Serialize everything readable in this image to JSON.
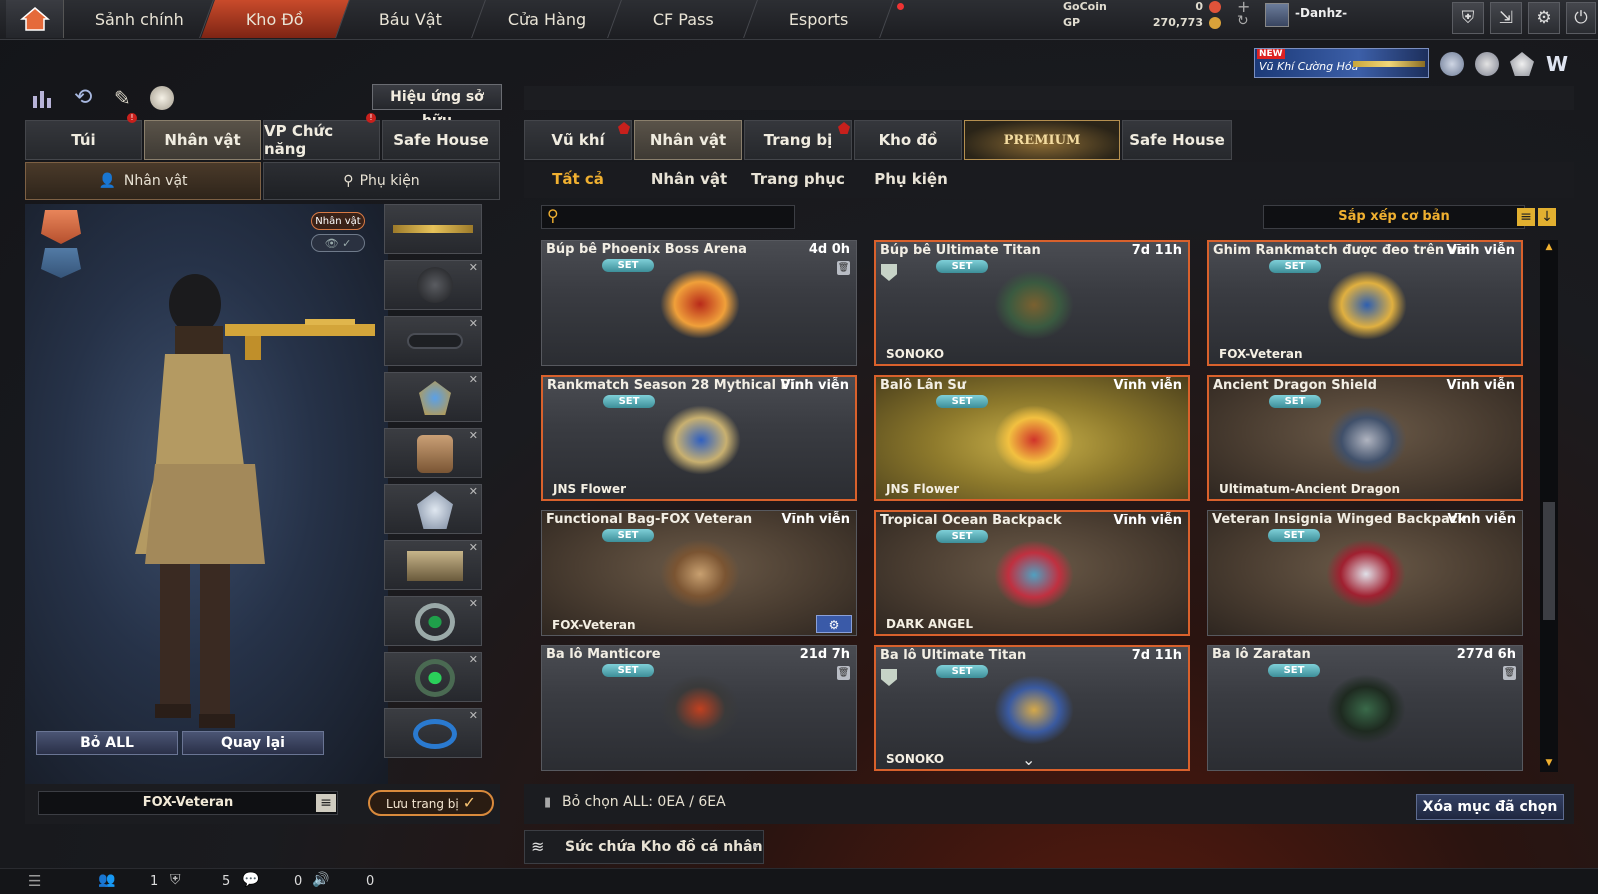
{
  "nav": {
    "tabs": [
      "Sảnh chính",
      "Kho Đồ",
      "Báu Vật",
      "Cửa Hàng",
      "CF Pass",
      "Esports"
    ],
    "active": "Kho Đồ"
  },
  "currency": {
    "gocoin_label": "GoCoin",
    "gocoin_value": "0",
    "gp_label": "GP",
    "gp_value": "270,773"
  },
  "player": {
    "name": "-Danhz-"
  },
  "banner": {
    "new_label": "NEW",
    "title": "Vũ Khí Cường Hóa"
  },
  "left": {
    "effect_button": "Hiệu ứng sở hữu",
    "tabs": [
      "Túi",
      "Nhân vật",
      "VP Chức năng",
      "Safe House"
    ],
    "subtabs": [
      "Nhân vật",
      "Phụ kiện"
    ],
    "char_badge": "Nhân vật ✓",
    "remove_all": "Bỏ ALL",
    "back": "Quay lại",
    "preset_name": "FOX-Veteran",
    "save_button": "Lưu trang bị"
  },
  "right": {
    "tabs": [
      "Vũ khí",
      "Nhân vật",
      "Trang bị",
      "Kho đồ",
      "PREMIUM",
      "Safe House"
    ],
    "subtabs": [
      "Tất cả",
      "Nhân vật",
      "Trang phục",
      "Phụ kiện"
    ],
    "search_placeholder": "",
    "sort_label": "Sắp xếp cơ bản",
    "set_label": "SET",
    "selection_info": "Bỏ chọn ALL: 0EA / 6EA",
    "delete_button": "Xóa mục đã chọn",
    "capacity_label": "Sức chứa Kho đồ cá nhân",
    "items": [
      {
        "name": "Búp bê Phoenix Boss Arena",
        "time": "4d 0h",
        "owner": "",
        "style": "plain",
        "trash": true,
        "shield": false
      },
      {
        "name": "Búp bê Ultimate Titan",
        "time": "7d 11h",
        "owner": "SONOKO",
        "style": "orange",
        "trash": false,
        "shield": true
      },
      {
        "name": "Ghim Rankmatch được đeo trên vai",
        "time": "Vĩnh viễn",
        "owner": "FOX-Veteran",
        "style": "orange",
        "trash": false,
        "shield": false
      },
      {
        "name": "Rankmatch Season 28 Mythical Pin",
        "time": "Vĩnh viễn",
        "owner": "JNS Flower",
        "style": "orange",
        "trash": false,
        "shield": false
      },
      {
        "name": "Balô Lân Sư",
        "time": "Vĩnh viễn",
        "owner": "JNS Flower",
        "style": "gold",
        "trash": false,
        "shield": false
      },
      {
        "name": "Ancient Dragon Shield",
        "time": "Vĩnh viễn",
        "owner": "Ultimatum-Ancient Dragon",
        "style": "brownorange",
        "trash": false,
        "shield": false
      },
      {
        "name": "Functional Bag-FOX Veteran",
        "time": "Vĩnh viễn",
        "owner": "FOX-Veteran",
        "style": "brown",
        "trash": false,
        "shield": false
      },
      {
        "name": "Tropical Ocean Backpack",
        "time": "Vĩnh viễn",
        "owner": "DARK ANGEL",
        "style": "brownorange",
        "trash": false,
        "shield": false
      },
      {
        "name": "Veteran Insignia Winged Backpack",
        "time": "Vĩnh viễn",
        "owner": "",
        "style": "brown",
        "trash": false,
        "shield": false
      },
      {
        "name": "Ba lô Manticore",
        "time": "21d 7h",
        "owner": "",
        "style": "plain",
        "trash": true,
        "shield": false
      },
      {
        "name": "Ba lô Ultimate Titan",
        "time": "7d 11h",
        "owner": "SONOKO",
        "style": "orange",
        "trash": false,
        "shield": true
      },
      {
        "name": "Ba lô Zaratan",
        "time": "277d 6h",
        "owner": "",
        "style": "plain",
        "trash": true,
        "shield": false
      }
    ]
  },
  "statusbar": {
    "v1": "1",
    "v2": "5",
    "v3": "0",
    "v4": "0"
  }
}
